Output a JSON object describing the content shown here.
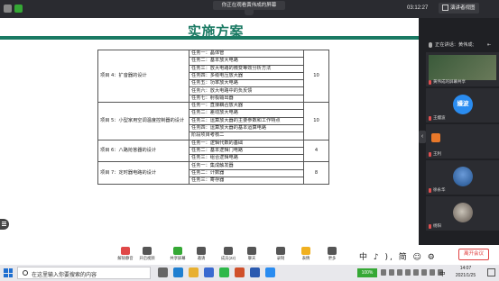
{
  "top_bar": {
    "banner": "你正在观看黄伟成的屏幕",
    "time": "03:12:27",
    "view_label": "演讲者视图"
  },
  "slide": {
    "title": "实施方案",
    "rows": [
      {
        "project": "项目 4：扩音器的设计",
        "hours": "10",
        "tasks": [
          "任务一：晶体管",
          "任务二：基本放大电路",
          "任务三：放大电路的微变等效分析方法",
          "任务四：多级电压放大器",
          "任务五：功率放大电路",
          "任务六：放大电路中的负反馈",
          "任务七：射极输出器"
        ]
      },
      {
        "project": "项目 5：小型家用空调温度控制器的设计",
        "hours": "10",
        "tasks": [
          "任务一：直接耦合放大器",
          "任务二：差动放大电路",
          "任务三：运算放大器的主要参数和工作特点",
          "任务四：运算放大器的基本运算电路",
          "阶段项目考核二"
        ]
      },
      {
        "project": "项目 6：八路抢答器的设计",
        "hours": "4",
        "tasks": [
          "任务一：逻辑代数的基础",
          "任务二：基本逻辑门电路",
          "任务三：组合逻辑电路"
        ]
      },
      {
        "project": "项目 7：定时器电路的设计",
        "hours": "8",
        "tasks": [
          "任务一：集成触发器",
          "任务二：计数器",
          "任务三：寄存器"
        ]
      }
    ]
  },
  "panel": {
    "speaking": "正在讲话：黄伟成;",
    "participants": [
      {
        "name": "黄伟成的屏幕共享"
      },
      {
        "name": "王嫚波",
        "avatar_text": "嫚波"
      },
      {
        "name": "王利"
      },
      {
        "name": "徐永华"
      },
      {
        "name": "杨阳"
      }
    ]
  },
  "toolbar": {
    "items": [
      {
        "label": "解除静音",
        "icon": "mic-muted-icon",
        "color": "#e04848"
      },
      {
        "label": "开启视频",
        "icon": "video-off-icon",
        "color": "#555555"
      },
      {
        "label": "共享屏幕",
        "icon": "share-screen-icon",
        "color": "#35a835"
      },
      {
        "label": "邀请",
        "icon": "invite-icon",
        "color": "#555555"
      },
      {
        "label": "成员(22)",
        "icon": "members-icon",
        "color": "#555555"
      },
      {
        "label": "聊天",
        "icon": "chat-icon",
        "color": "#555555"
      },
      {
        "label": "录制",
        "icon": "record-icon",
        "color": "#555555"
      },
      {
        "label": "表情",
        "icon": "emoji-icon",
        "color": "#f0b020"
      },
      {
        "label": "更多",
        "icon": "more-icon",
        "color": "#555555"
      }
    ],
    "ime": "中 ♪ ), 简 ☺ ⚙",
    "leave_label": "离开会议"
  },
  "taskbar": {
    "search_placeholder": "在这里输入你要搜索的内容",
    "battery": "100%",
    "ime": "中",
    "time": "14:07",
    "date": "2021/1/25"
  }
}
